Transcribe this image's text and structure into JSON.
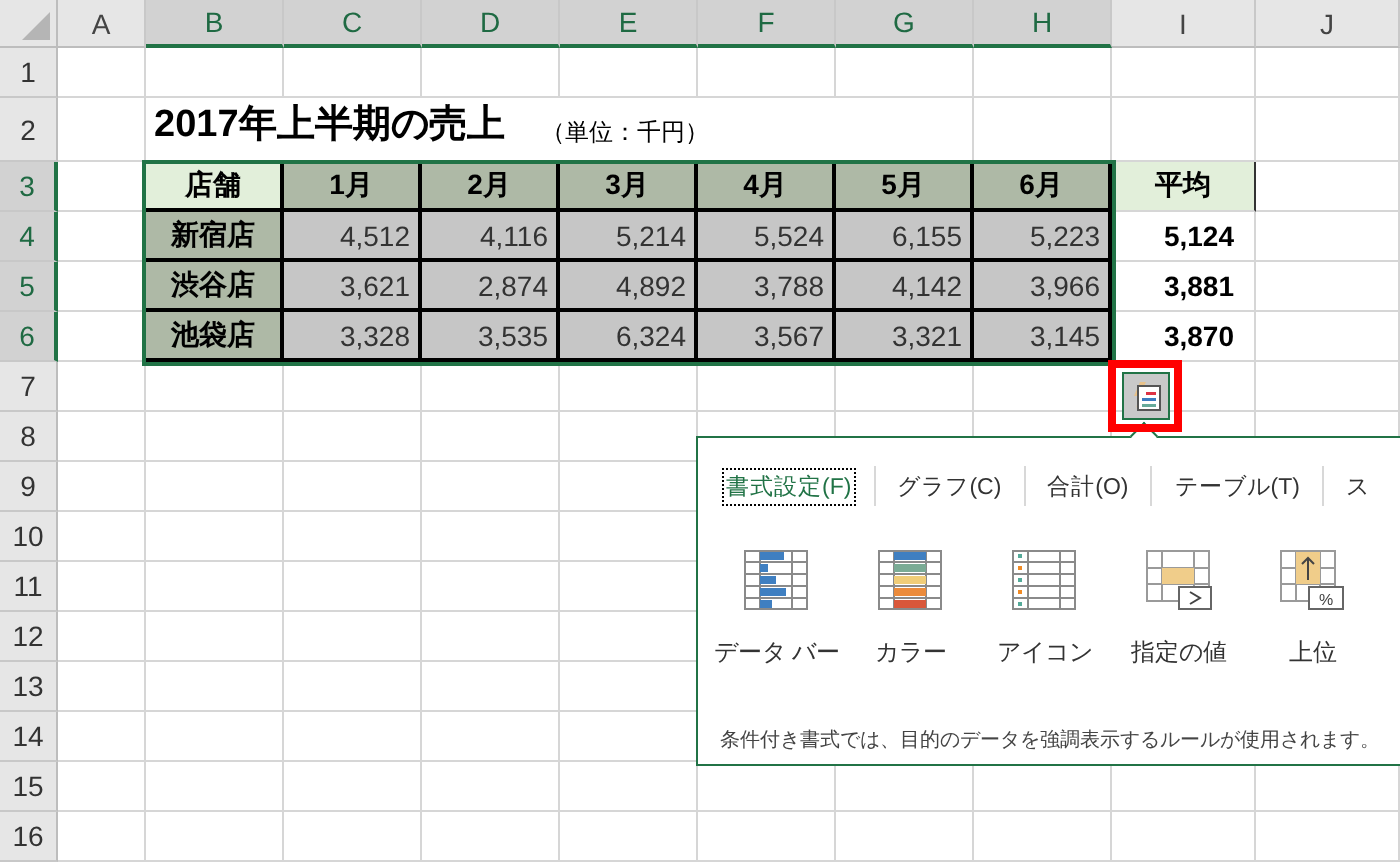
{
  "column_headers": [
    {
      "label": "A",
      "selected": false
    },
    {
      "label": "B",
      "selected": true
    },
    {
      "label": "C",
      "selected": true
    },
    {
      "label": "D",
      "selected": true
    },
    {
      "label": "E",
      "selected": true
    },
    {
      "label": "F",
      "selected": true
    },
    {
      "label": "G",
      "selected": true
    },
    {
      "label": "H",
      "selected": true
    },
    {
      "label": "I",
      "selected": false
    },
    {
      "label": "J",
      "selected": false
    }
  ],
  "row_headers": [
    {
      "label": "1",
      "selected": false
    },
    {
      "label": "2",
      "selected": false
    },
    {
      "label": "3",
      "selected": true
    },
    {
      "label": "4",
      "selected": true
    },
    {
      "label": "5",
      "selected": true
    },
    {
      "label": "6",
      "selected": true
    },
    {
      "label": "7",
      "selected": false
    },
    {
      "label": "8",
      "selected": false
    },
    {
      "label": "9",
      "selected": false
    },
    {
      "label": "10",
      "selected": false
    },
    {
      "label": "11",
      "selected": false
    },
    {
      "label": "12",
      "selected": false
    },
    {
      "label": "13",
      "selected": false
    },
    {
      "label": "14",
      "selected": false
    },
    {
      "label": "15",
      "selected": false
    },
    {
      "label": "16",
      "selected": false
    }
  ],
  "title": "2017年上半期の売上",
  "unit": "（単位：千円）",
  "table": {
    "columns": [
      "店舗",
      "1月",
      "2月",
      "3月",
      "4月",
      "5月",
      "6月"
    ],
    "rows": [
      {
        "store": "新宿店",
        "values": [
          "4,512",
          "4,116",
          "5,214",
          "5,524",
          "6,155",
          "5,223"
        ]
      },
      {
        "store": "渋谷店",
        "values": [
          "3,621",
          "2,874",
          "4,892",
          "3,788",
          "4,142",
          "3,966"
        ]
      },
      {
        "store": "池袋店",
        "values": [
          "3,328",
          "3,535",
          "6,324",
          "3,567",
          "3,321",
          "3,145"
        ]
      }
    ]
  },
  "average": {
    "header": "平均",
    "values": [
      "5,124",
      "3,881",
      "3,870"
    ]
  },
  "quick_analysis": {
    "tabs": [
      {
        "label": "書式設定(F)",
        "selected": true
      },
      {
        "label": "グラフ(C)",
        "selected": false
      },
      {
        "label": "合計(O)",
        "selected": false
      },
      {
        "label": "テーブル(T)",
        "selected": false
      },
      {
        "label": "ス",
        "selected": false
      }
    ],
    "options": [
      {
        "label": "データ バー",
        "kind": "databar"
      },
      {
        "label": "カラー",
        "kind": "color"
      },
      {
        "label": "アイコン",
        "kind": "iconset"
      },
      {
        "label": "指定の値",
        "kind": "greater"
      },
      {
        "label": "上位",
        "kind": "top",
        "badge": "%"
      }
    ],
    "description": "条件付き書式では、目的のデータを強調表示するルールが使用されます。"
  }
}
